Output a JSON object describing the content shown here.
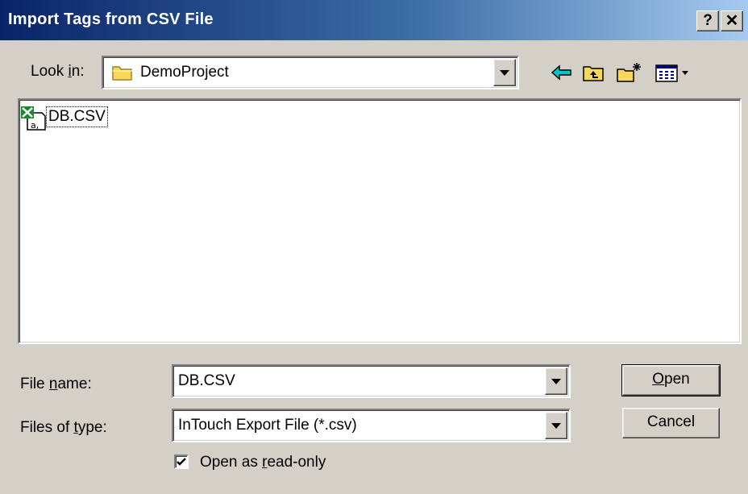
{
  "window": {
    "title": "Import Tags from CSV File",
    "help_glyph": "?",
    "close_glyph": "✕"
  },
  "look_in": {
    "label_pre": "Look ",
    "label_accel": "i",
    "label_post": "n:",
    "value": "DemoProject"
  },
  "toolbar": {
    "back_icon": "back-arrow-icon",
    "up_icon": "up-one-level-icon",
    "new_folder_icon": "new-folder-icon",
    "view_menu_icon": "view-menu-icon"
  },
  "file_list": {
    "items": [
      {
        "name": "DB.CSV",
        "icon": "excel-csv-file-icon"
      }
    ]
  },
  "file_name": {
    "label_pre": "File ",
    "label_accel": "n",
    "label_post": "ame:",
    "value": "DB.CSV"
  },
  "file_type": {
    "label_pre": "Files of ",
    "label_accel": "t",
    "label_post": "ype:",
    "value": "InTouch Export File (*.csv)"
  },
  "read_only": {
    "label_pre": "Open as ",
    "label_accel": "r",
    "label_post": "ead-only",
    "checked": true
  },
  "buttons": {
    "open": {
      "accel": "O",
      "rest": "pen"
    },
    "cancel": "Cancel"
  },
  "colors": {
    "face": "#d4d0c8",
    "title_start": "#0a246a",
    "title_end": "#a6caf0",
    "accent_cyan": "#00c0c0",
    "folder_yellow": "#f8d858"
  }
}
